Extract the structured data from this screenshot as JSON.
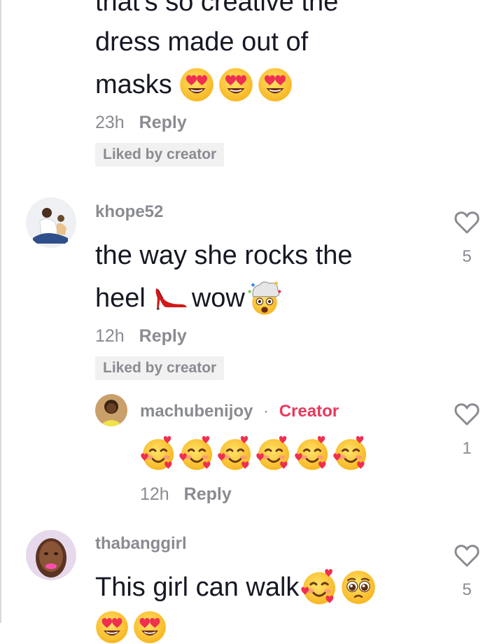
{
  "comment1": {
    "text_top": "that's so creative the",
    "text_line2": "dress made out of",
    "text_line3": "masks",
    "emojis": [
      "smiling-face-with-heart-eyes",
      "smiling-face-with-heart-eyes",
      "smiling-face-with-heart-eyes"
    ],
    "time": "23h",
    "reply_label": "Reply",
    "liked_badge": "Liked by creator"
  },
  "comment2": {
    "username": "khope52",
    "text_line1": "the way she rocks the",
    "text_line2a": "heel",
    "text_line2b": "wow",
    "emojis": [
      "high-heeled-shoe",
      "exploding-head"
    ],
    "time": "12h",
    "reply_label": "Reply",
    "liked_badge": "Liked by creator",
    "like_count": "5"
  },
  "reply1": {
    "username": "machubenijoy",
    "separator": "·",
    "creator_label": "Creator",
    "emojis": [
      "smiling-face-with-hearts",
      "smiling-face-with-hearts",
      "smiling-face-with-hearts",
      "smiling-face-with-hearts",
      "smiling-face-with-hearts",
      "smiling-face-with-hearts"
    ],
    "time": "12h",
    "reply_label": "Reply",
    "like_count": "1"
  },
  "comment3": {
    "username": "thabanggirl",
    "text_line1": "This girl can walk",
    "emojis": [
      "smiling-face-with-hearts",
      "pleading-face"
    ],
    "like_count": "5"
  },
  "colors": {
    "creator_accent": "#e8395d",
    "muted": "#8a8b91",
    "badge_bg": "#f1f1f2"
  }
}
